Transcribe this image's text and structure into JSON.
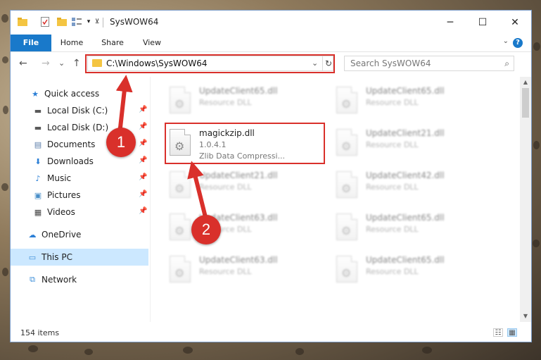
{
  "window": {
    "title": "SysWOW64",
    "controls": {
      "minimize": "─",
      "maximize": "☐",
      "close": "✕"
    }
  },
  "quick_access_toolbar": {
    "dropdown_glyph": "▾"
  },
  "ribbon": {
    "tabs": [
      {
        "label": "File"
      },
      {
        "label": "Home"
      },
      {
        "label": "Share"
      },
      {
        "label": "View"
      }
    ],
    "help": "?",
    "collapse_glyph": "⌄"
  },
  "navigation": {
    "back": "←",
    "forward": "→",
    "recent": "⌄",
    "up": "↑"
  },
  "address": {
    "path": "C:\\Windows\\SysWOW64",
    "dropdown_glyph": "⌄",
    "refresh_glyph": "↻"
  },
  "search": {
    "placeholder": "Search SysWOW64",
    "icon_glyph": "⌕"
  },
  "nav_pane": {
    "items": [
      {
        "label": "Quick access",
        "icon": "star-icon",
        "glyph": "★",
        "color": "#2b7fd6"
      },
      {
        "label": "Local Disk (C:)",
        "icon": "drive-icon",
        "glyph": "▬",
        "color": "#5a5a5a",
        "pin": "📌"
      },
      {
        "label": "Local Disk (D:)",
        "icon": "drive-icon",
        "glyph": "▬",
        "color": "#5a5a5a",
        "pin": "📌"
      },
      {
        "label": "Documents",
        "icon": "documents-icon",
        "glyph": "▤",
        "color": "#5a7ca8",
        "pin": "📌"
      },
      {
        "label": "Downloads",
        "icon": "download-icon",
        "glyph": "⬇",
        "color": "#2b7fd6",
        "pin": "📌"
      },
      {
        "label": "Music",
        "icon": "music-icon",
        "glyph": "♪",
        "color": "#2b7fd6",
        "pin": "📌"
      },
      {
        "label": "Pictures",
        "icon": "pictures-icon",
        "glyph": "▣",
        "color": "#4a8fc8",
        "pin": "📌"
      },
      {
        "label": "Videos",
        "icon": "videos-icon",
        "glyph": "▦",
        "color": "#444444",
        "pin": "📌"
      },
      {
        "label": "OneDrive",
        "icon": "cloud-icon",
        "glyph": "☁",
        "color": "#2b7fd6"
      },
      {
        "label": "This PC",
        "icon": "computer-icon",
        "glyph": "▭",
        "color": "#3b8ed8",
        "selected": true
      },
      {
        "label": "Network",
        "icon": "network-icon",
        "glyph": "⧉",
        "color": "#3b8ed8"
      }
    ]
  },
  "files": [
    {
      "name": "UpdateClient65.dll",
      "type": "Resource DLL"
    },
    {
      "name": "UpdateClient65.dll",
      "type": "Resource DLL"
    },
    {
      "name": "magickzip.dll",
      "version": "1.0.4.1",
      "description": "Zlib Data Compressi...",
      "highlighted": true
    },
    {
      "name": "UpdateClient21.dll",
      "type": "Resource DLL"
    },
    {
      "name": "UpdateClient21.dll",
      "type": "Resource DLL"
    },
    {
      "name": "UpdateClient42.dll",
      "type": "Resource DLL"
    },
    {
      "name": "UpdateClient63.dll",
      "type": "Resource DLL"
    },
    {
      "name": "UpdateClient65.dll",
      "type": "Resource DLL"
    },
    {
      "name": "UpdateClient63.dll",
      "type": "Resource DLL"
    },
    {
      "name": "UpdateClient65.dll",
      "type": "Resource DLL"
    }
  ],
  "status": {
    "item_count": "154 items"
  },
  "scrollbar": {
    "up": "▲",
    "down": "▼"
  },
  "view_toggles": {
    "details": "☷",
    "large_icons": "▦"
  },
  "annotations": {
    "step1": "1",
    "step2": "2",
    "color": "#d9302b"
  }
}
